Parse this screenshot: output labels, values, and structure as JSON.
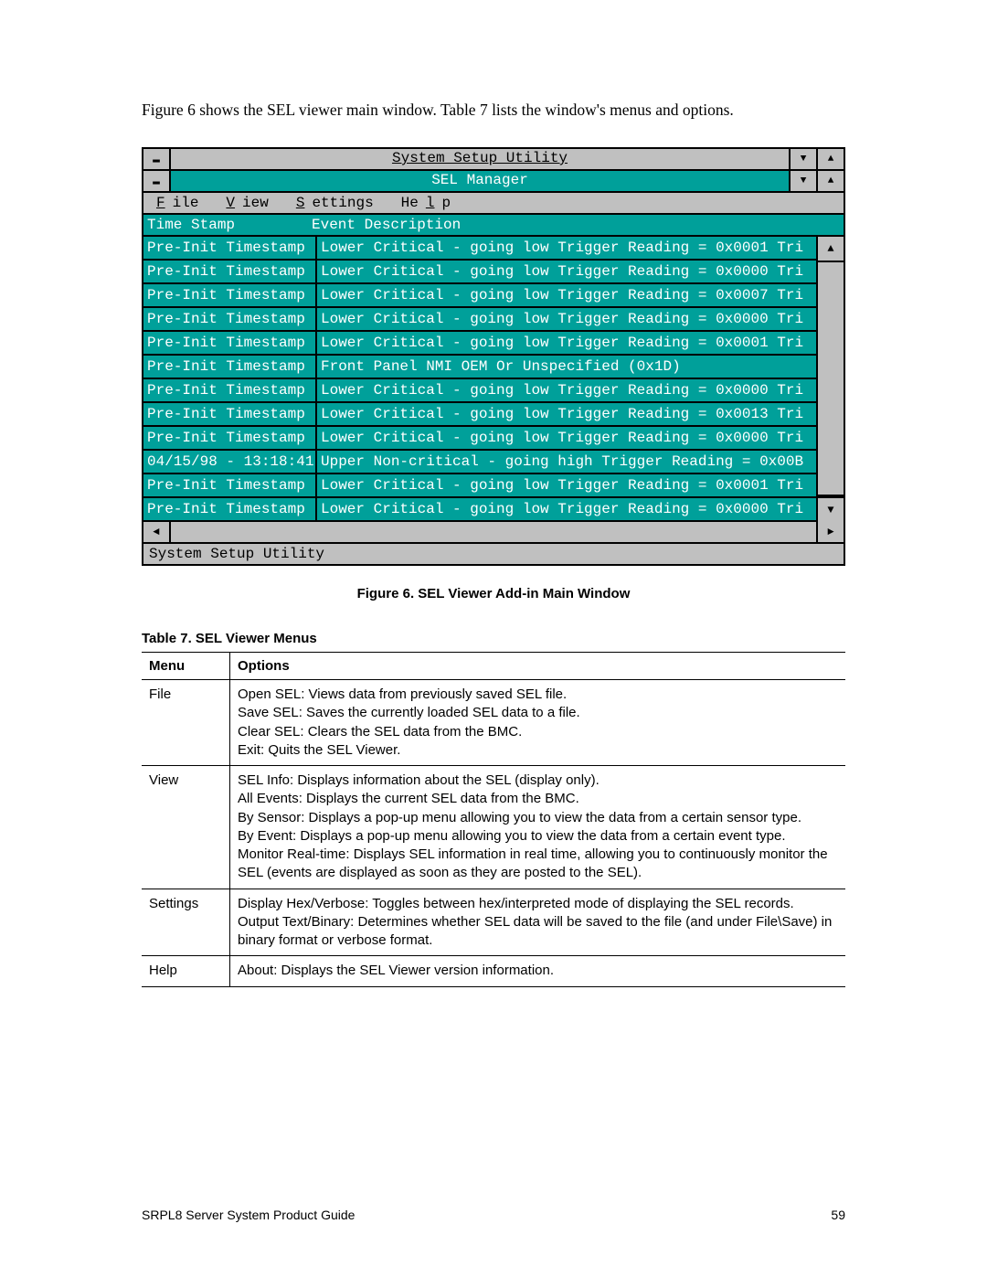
{
  "intro": "Figure 6 shows the SEL viewer main window.  Table 7 lists the window's menus and options.",
  "outer_title": "System Setup Utility",
  "inner_title": "SEL Manager",
  "menubar": [
    {
      "hot": "F",
      "rest": "ile"
    },
    {
      "hot": "V",
      "rest": "iew"
    },
    {
      "hot": "S",
      "rest": "ettings"
    },
    {
      "hot": "",
      "rest": "He",
      "hot2": "l",
      "rest2": "p"
    }
  ],
  "cols": {
    "c1": "Time Stamp",
    "c2": "Event Description"
  },
  "rows": [
    {
      "ts": "Pre-Init Timestamp",
      "ev": "Lower Critical - going low Trigger Reading = 0x0001 Tri"
    },
    {
      "ts": "Pre-Init Timestamp",
      "ev": "Lower Critical - going low Trigger Reading = 0x0000 Tri"
    },
    {
      "ts": "Pre-Init Timestamp",
      "ev": "Lower Critical - going low Trigger Reading = 0x0007 Tri"
    },
    {
      "ts": "Pre-Init Timestamp",
      "ev": "Lower Critical - going low Trigger Reading = 0x0000 Tri"
    },
    {
      "ts": "Pre-Init Timestamp",
      "ev": "Lower Critical - going low Trigger Reading = 0x0001 Tri"
    },
    {
      "ts": "Pre-Init Timestamp",
      "ev": "Front Panel NMI OEM Or Unspecified (0x1D)"
    },
    {
      "ts": "Pre-Init Timestamp",
      "ev": "Lower Critical - going low Trigger Reading = 0x0000 Tri"
    },
    {
      "ts": "Pre-Init Timestamp",
      "ev": "Lower Critical - going low Trigger Reading = 0x0013 Tri"
    },
    {
      "ts": "Pre-Init Timestamp",
      "ev": "Lower Critical - going low Trigger Reading = 0x0000 Tri"
    },
    {
      "ts": "04/15/98 - 13:18:41",
      "ev": "Upper Non-critical - going high Trigger Reading = 0x00B"
    },
    {
      "ts": "Pre-Init Timestamp",
      "ev": "Lower Critical - going low Trigger Reading = 0x0001 Tri"
    },
    {
      "ts": "Pre-Init Timestamp",
      "ev": "Lower Critical - going low Trigger Reading = 0x0000 Tri"
    }
  ],
  "statusbar": "System Setup Utility",
  "figcap": "Figure 6.  SEL Viewer Add-in Main Window",
  "tablecap": "Table 7.      SEL Viewer Menus",
  "th1": "Menu",
  "th2": "Options",
  "menus": [
    {
      "m": "File",
      "o": "Open SEL:  Views data from previously saved SEL file.\nSave SEL:  Saves the currently loaded SEL data to a file.\nClear SEL:  Clears the SEL data from the BMC.\nExit:  Quits the SEL Viewer."
    },
    {
      "m": "View",
      "o": "SEL Info:  Displays information about the SEL (display only).\nAll Events:  Displays the current SEL data from the BMC.\nBy Sensor:  Displays a pop-up menu allowing you to view the data from a certain sensor type.\nBy Event:  Displays a pop-up menu allowing you to view the data from a certain event type.\nMonitor Real-time:  Displays SEL information in real time, allowing you to continuously monitor the SEL (events are displayed as soon as they are posted to the SEL)."
    },
    {
      "m": "Settings",
      "o": "Display Hex/Verbose:  Toggles between hex/interpreted mode of displaying the SEL records.\nOutput Text/Binary:  Determines whether SEL data will be saved to the file (and under File\\Save) in binary format or verbose format."
    },
    {
      "m": "Help",
      "o": "About:  Displays the SEL Viewer version information."
    }
  ],
  "footer_left": "SRPL8 Server System Product Guide",
  "footer_right": "59"
}
